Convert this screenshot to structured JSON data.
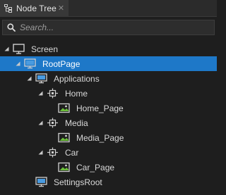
{
  "tab": {
    "title": "Node Tree",
    "icon": "node-tree-icon",
    "close_icon": "close-icon",
    "close_glyph": "✕"
  },
  "search": {
    "placeholder": "Search...",
    "value": ""
  },
  "colors": {
    "selection": "#1e78c8",
    "background": "#1e1e1e",
    "tab_active": "#383838"
  },
  "tree": [
    {
      "label": "Screen",
      "icon": "screen-icon",
      "expanded": true,
      "selected": false,
      "depth": 0
    },
    {
      "label": "RootPage",
      "icon": "page-icon",
      "expanded": true,
      "selected": true,
      "depth": 1
    },
    {
      "label": "Applications",
      "icon": "page-icon",
      "expanded": true,
      "selected": false,
      "depth": 2
    },
    {
      "label": "Home",
      "icon": "node-icon",
      "expanded": true,
      "selected": false,
      "depth": 3
    },
    {
      "label": "Home_Page",
      "icon": "image-icon",
      "expanded": false,
      "selected": false,
      "depth": 4
    },
    {
      "label": "Media",
      "icon": "node-icon",
      "expanded": true,
      "selected": false,
      "depth": 3
    },
    {
      "label": "Media_Page",
      "icon": "image-icon",
      "expanded": false,
      "selected": false,
      "depth": 4
    },
    {
      "label": "Car",
      "icon": "node-icon",
      "expanded": true,
      "selected": false,
      "depth": 3
    },
    {
      "label": "Car_Page",
      "icon": "image-icon",
      "expanded": false,
      "selected": false,
      "depth": 4
    },
    {
      "label": "SettingsRoot",
      "icon": "page-icon",
      "expanded": false,
      "selected": false,
      "depth": 2
    }
  ]
}
